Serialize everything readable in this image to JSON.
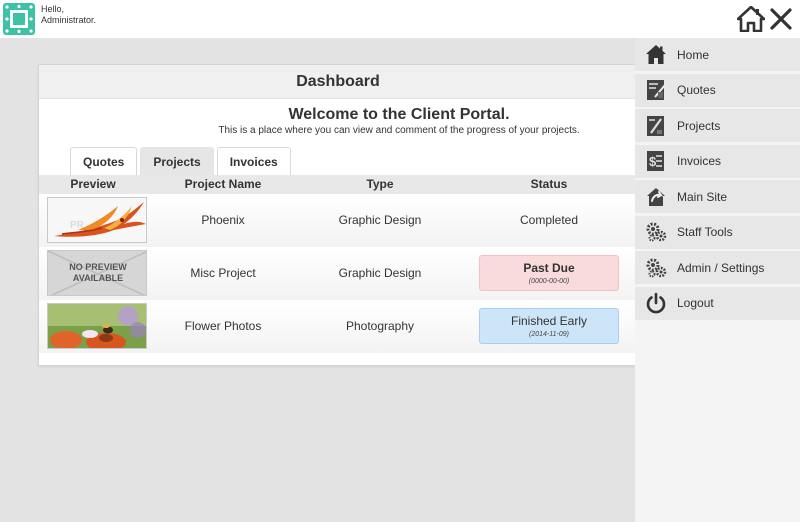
{
  "header": {
    "greeting_line1": "Hello,",
    "greeting_line2": "Administrator."
  },
  "card": {
    "title": "Dashboard",
    "welcome": "Welcome to the Client Portal.",
    "subtitle": "This is a place where you can view and comment of the progress of your projects."
  },
  "tabs": [
    {
      "label": "Quotes",
      "active": true
    },
    {
      "label": "Projects",
      "active": false
    },
    {
      "label": "Invoices",
      "active": false
    }
  ],
  "table": {
    "columns": [
      "Preview",
      "Project Name",
      "Type",
      "Status"
    ],
    "rows": [
      {
        "preview": "phoenix-image",
        "name": "Phoenix",
        "type": "Graphic Design",
        "status": "Completed",
        "date": ""
      },
      {
        "preview": "no-preview",
        "preview_text_1": "NO PREVIEW",
        "preview_text_2": "AVAILABLE",
        "name": "Misc Project",
        "type": "Graphic Design",
        "status": "Past Due",
        "date": "(0000-00-00)"
      },
      {
        "preview": "flower-image",
        "name": "Flower Photos",
        "type": "Photography",
        "status": "Finished Early",
        "date": "(2014-11-09)"
      }
    ]
  },
  "sidebar": {
    "items": [
      {
        "label": "Home",
        "icon": "home-icon"
      },
      {
        "label": "Quotes",
        "icon": "quotes-icon"
      },
      {
        "label": "Projects",
        "icon": "projects-icon"
      },
      {
        "label": "Invoices",
        "icon": "invoices-icon"
      },
      {
        "label": "Main Site",
        "icon": "main-site-icon"
      },
      {
        "label": "Staff Tools",
        "icon": "gears-icon"
      },
      {
        "label": "Admin / Settings",
        "icon": "gears-icon"
      },
      {
        "label": "Logout",
        "icon": "power-icon"
      }
    ]
  },
  "colors": {
    "logo": "#3cc3a5",
    "past_due_bg": "#fadbdb",
    "finished_early_bg": "#cde5f9"
  }
}
